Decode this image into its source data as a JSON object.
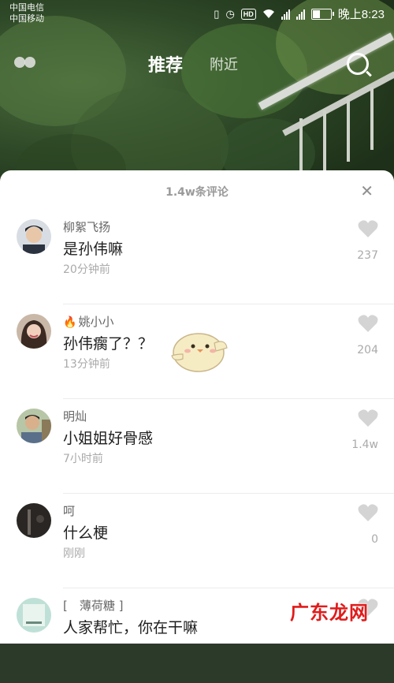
{
  "status_bar": {
    "carrier_1": "中国电信",
    "carrier_2": "中国移动",
    "hd_badge": "HD",
    "time": "晚上8:23"
  },
  "nav": {
    "tab_recommend": "推荐",
    "tab_nearby": "附近"
  },
  "comments_panel": {
    "title": "1.4w条评论",
    "close_label": "✕",
    "items": [
      {
        "username": "柳絮飞扬",
        "text": "是孙伟嘛",
        "time": "20分钟前",
        "likes": "237"
      },
      {
        "username": "姚小小",
        "text": "孙伟瘸了？？",
        "time": "13分钟前",
        "likes": "204"
      },
      {
        "username": "明灿",
        "text": "小姐姐好骨感",
        "time": "7小时前",
        "likes": "1.4w"
      },
      {
        "username": "呵",
        "text": "什么梗",
        "time": "刚刚",
        "likes": "0"
      },
      {
        "username": "[　薄荷糖 ]",
        "text": "人家帮忙，你在干嘛",
        "time": "",
        "likes": ""
      }
    ]
  },
  "watermark": "广东龙网",
  "icons": [
    "vibrate-icon",
    "alarm-icon",
    "wifi-icon",
    "signal-icon",
    "battery-icon",
    "search-icon",
    "close-icon",
    "heart-icon",
    "fire-icon",
    "chick-sticker"
  ],
  "colors": {
    "accent_watermark": "#e11b1b",
    "text_primary": "#1e1e1e",
    "text_secondary": "#aaaaaa"
  }
}
